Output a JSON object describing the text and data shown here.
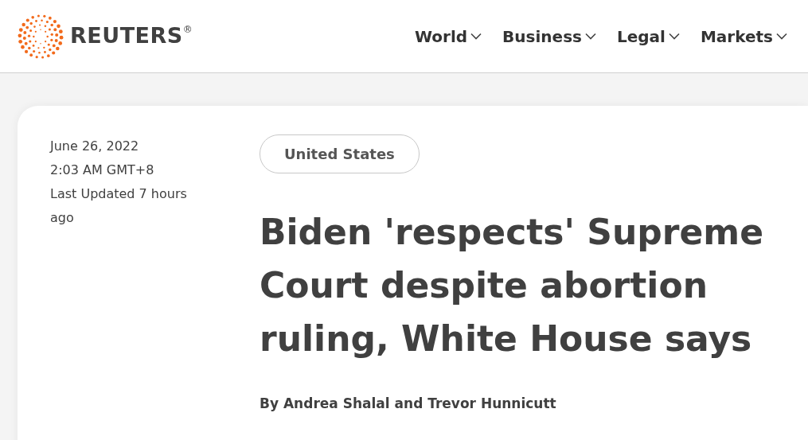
{
  "header": {
    "logo_text": "REUTERS$^{®}$",
    "nav": [
      {
        "label": "World"
      },
      {
        "label": "Business"
      },
      {
        "label": "Legal"
      },
      {
        "label": "Markets"
      }
    ]
  },
  "article": {
    "date": "June 26, 2022",
    "time": "2:03 AM GMT+8",
    "updated": "Last Updated 7 hours ago",
    "topic": "United States",
    "headline": "Biden 'respects' Supreme Court despite abortion ruling, White House says",
    "byline": "By Andrea Shalal and Trevor Hunnicutt"
  }
}
